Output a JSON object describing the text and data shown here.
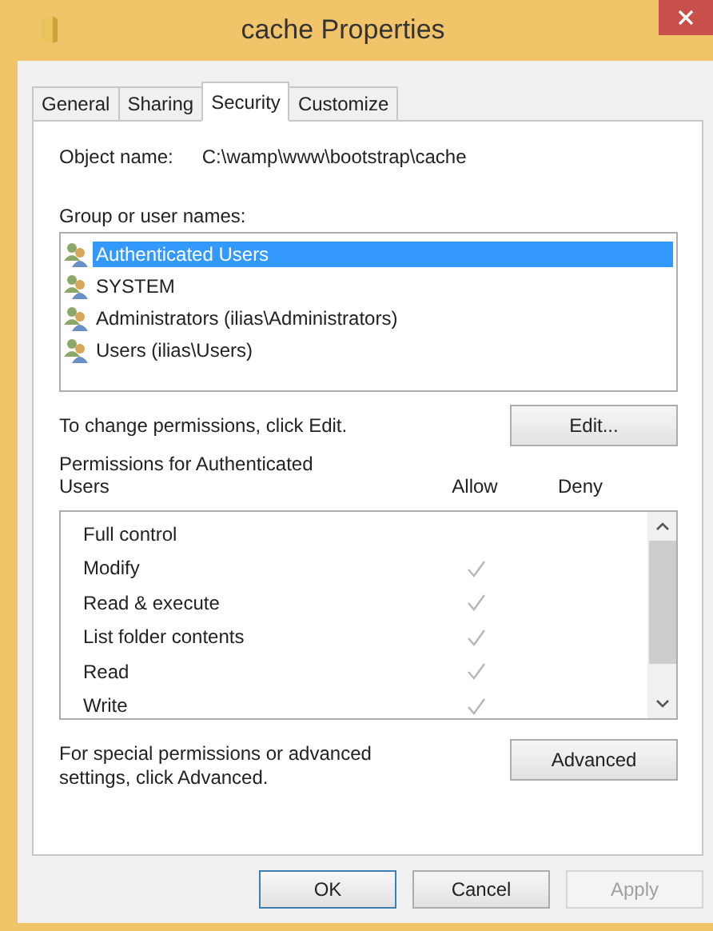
{
  "window": {
    "title": "cache Properties"
  },
  "tabs": [
    {
      "label": "General",
      "selected": false
    },
    {
      "label": "Sharing",
      "selected": false
    },
    {
      "label": "Security",
      "selected": true
    },
    {
      "label": "Customize",
      "selected": false
    }
  ],
  "object_name": {
    "label": "Object name:",
    "value": "C:\\wamp\\www\\bootstrap\\cache"
  },
  "groups": {
    "label": "Group or user names:",
    "items": [
      {
        "name": "Authenticated Users",
        "selected": true
      },
      {
        "name": "SYSTEM",
        "selected": false
      },
      {
        "name": "Administrators (ilias\\Administrators)",
        "selected": false
      },
      {
        "name": "Users (ilias\\Users)",
        "selected": false
      }
    ]
  },
  "edit_hint": "To change permissions, click Edit.",
  "edit_button": "Edit...",
  "permissions": {
    "label": "Permissions for Authenticated Users",
    "allow_header": "Allow",
    "deny_header": "Deny",
    "rows": [
      {
        "name": "Full control",
        "allow": false,
        "deny": false
      },
      {
        "name": "Modify",
        "allow": true,
        "deny": false
      },
      {
        "name": "Read & execute",
        "allow": true,
        "deny": false
      },
      {
        "name": "List folder contents",
        "allow": true,
        "deny": false
      },
      {
        "name": "Read",
        "allow": true,
        "deny": false
      },
      {
        "name": "Write",
        "allow": true,
        "deny": false
      }
    ]
  },
  "advanced_hint": "For special permissions or advanced settings, click Advanced.",
  "advanced_button": "Advanced",
  "buttons": [
    {
      "label": "OK",
      "default": true,
      "disabled": false
    },
    {
      "label": "Cancel",
      "default": false,
      "disabled": false
    },
    {
      "label": "Apply",
      "default": false,
      "disabled": true
    }
  ]
}
